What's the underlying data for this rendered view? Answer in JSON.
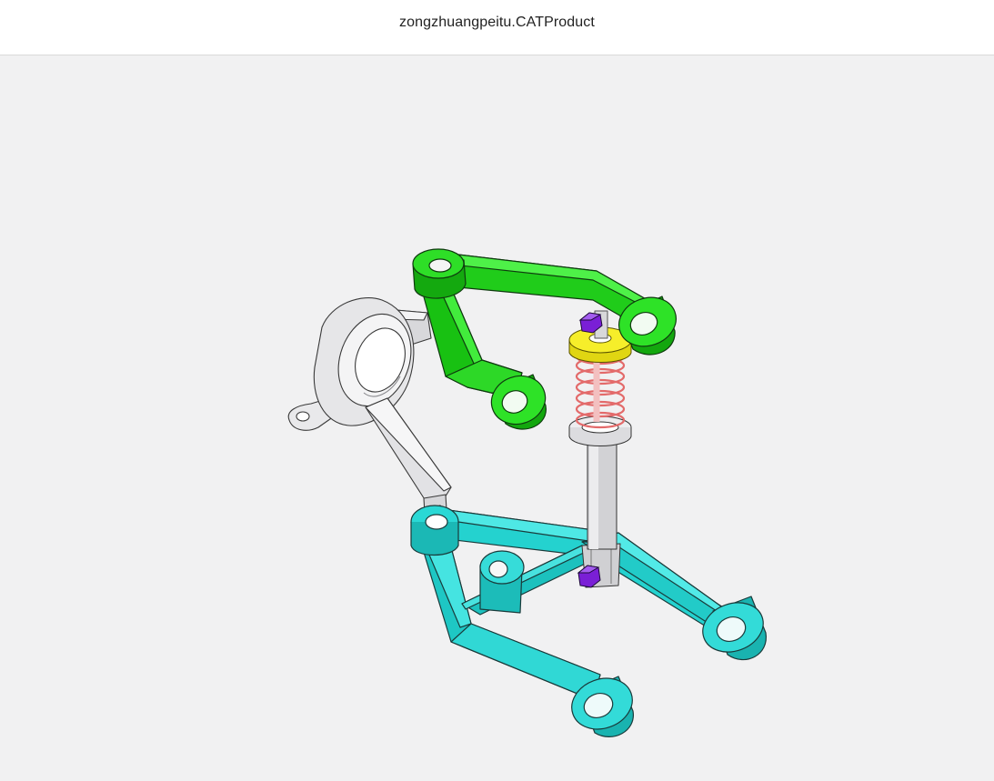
{
  "window": {
    "title": "zongzhuangpeitu.CATProduct"
  },
  "viewer": {
    "background": "#f1f1f2",
    "parts": [
      {
        "name": "upper-control-arm",
        "color": "#22e61b"
      },
      {
        "name": "lower-control-arm",
        "color": "#22d6d3"
      },
      {
        "name": "steering-knuckle",
        "color": "#e4e4e6"
      },
      {
        "name": "shock-absorber-spring",
        "color": "#f08c8c"
      },
      {
        "name": "spring-seat",
        "color": "#f2ea1c"
      },
      {
        "name": "shock-absorber-rod",
        "color": "#d3d3d6"
      },
      {
        "name": "nut",
        "color": "#7a1fd6"
      }
    ]
  }
}
